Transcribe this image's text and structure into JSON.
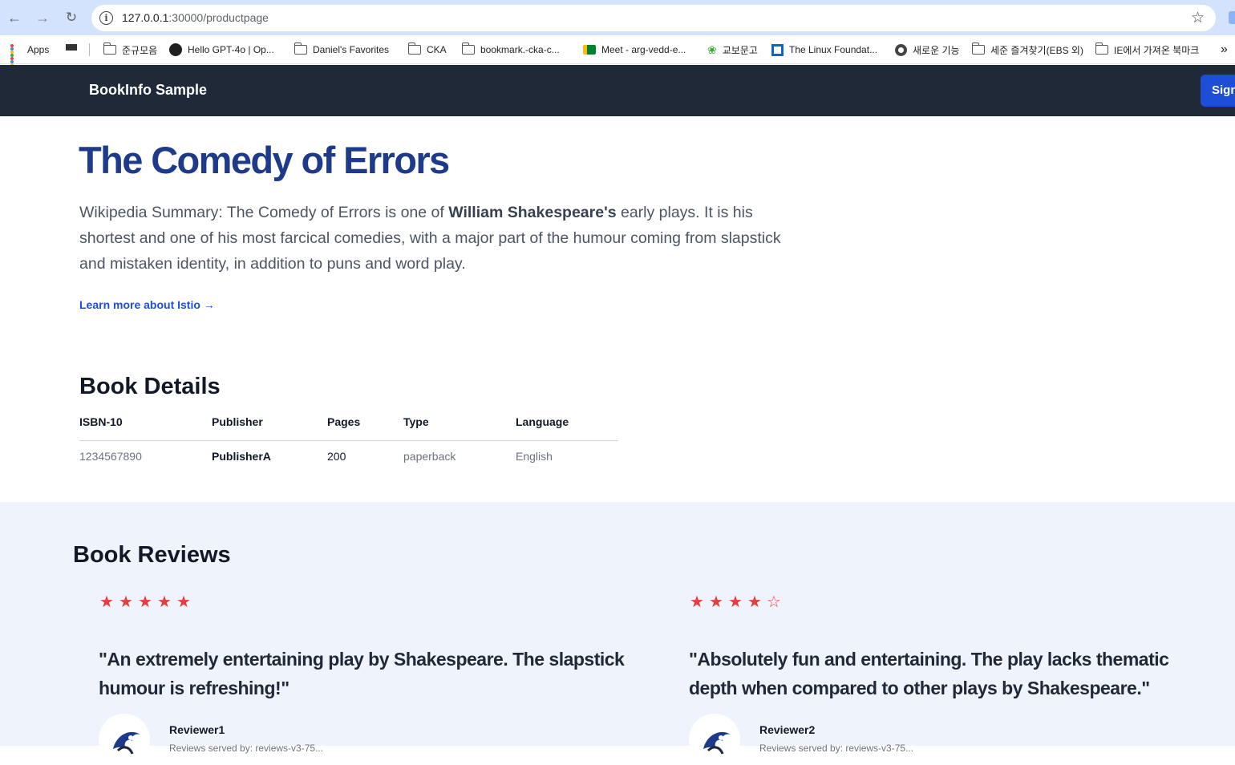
{
  "browser": {
    "url_host": "127.0.0.1",
    "url_path": ":30000/productpage",
    "bookmarks": [
      {
        "label": "Apps",
        "icon": "apps-icon"
      },
      {
        "label": "",
        "icon": "grid-icon"
      },
      {
        "label": "준규모음",
        "icon": "folder-icon"
      },
      {
        "label": "Hello GPT-4o | Op...",
        "icon": "openai-icon"
      },
      {
        "label": "Daniel's Favorites",
        "icon": "folder-icon"
      },
      {
        "label": "CKA",
        "icon": "folder-icon"
      },
      {
        "label": "bookmark.-cka-c...",
        "icon": "folder-icon"
      },
      {
        "label": "Meet - arg-vedd-e...",
        "icon": "meet-icon"
      },
      {
        "label": "교보문고",
        "icon": "kyobo-icon"
      },
      {
        "label": "The Linux Foundat...",
        "icon": "linux-foundation-icon"
      },
      {
        "label": "새로운 기능",
        "icon": "chrome-icon"
      },
      {
        "label": "세준 즐겨찾기(EBS 외)",
        "icon": "folder-icon"
      },
      {
        "label": "IE에서 가져온 북마크",
        "icon": "folder-icon"
      }
    ],
    "more": "»"
  },
  "header": {
    "brand": "BookInfo Sample",
    "signin": "Sign in"
  },
  "product": {
    "title": "The Comedy of Errors",
    "summary_prefix": "Wikipedia Summary: The Comedy of Errors is one of ",
    "summary_bold": "William Shakespeare's",
    "summary_suffix": " early plays. It is his shortest and one of his most farcical comedies, with a major part of the humour coming from slapstick and mistaken identity, in addition to puns and word play.",
    "learn_more": "Learn more about Istio →"
  },
  "details": {
    "title": "Book Details",
    "columns": [
      "ISBN-10",
      "Publisher",
      "Pages",
      "Type",
      "Language"
    ],
    "row": [
      "1234567890",
      "PublisherA",
      "200",
      "paperback",
      "English"
    ]
  },
  "reviews": {
    "title": "Book Reviews",
    "items": [
      {
        "rating": 5,
        "max": 5,
        "text": "\"An extremely entertaining play by Shakespeare. The slapstick humour is refreshing!\"",
        "reviewer": "Reviewer1",
        "sub": "Reviews served by: reviews-v3-75..."
      },
      {
        "rating": 4,
        "max": 5,
        "text": "\"Absolutely fun and entertaining. The play lacks thematic depth when compared to other plays by Shakespeare.\"",
        "reviewer": "Reviewer2",
        "sub": "Reviews served by: reviews-v3-75..."
      }
    ],
    "star_color": "#e53e3e"
  },
  "colors": {
    "title": "#1e3a8a",
    "link": "#1d4ed8",
    "header_bg": "#1f2937",
    "reviews_bg": "#eff3fb"
  }
}
